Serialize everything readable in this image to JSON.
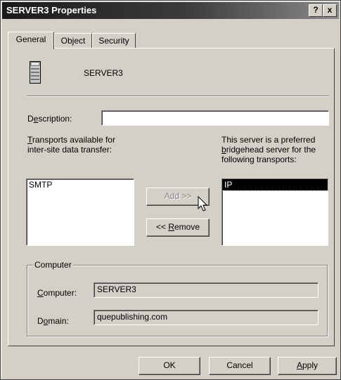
{
  "window": {
    "title": "SERVER3 Properties",
    "help_button": "?",
    "close_button": "x"
  },
  "tabs": [
    {
      "label": "General",
      "active": true
    },
    {
      "label": "Object",
      "active": false
    },
    {
      "label": "Security",
      "active": false
    }
  ],
  "server": {
    "icon": "server-icon",
    "name": "SERVER3"
  },
  "description": {
    "label_pre": "D",
    "label_u": "e",
    "label_post": "scription:",
    "value": ""
  },
  "transports_available": {
    "label_u": "T",
    "label_line1_post": "ransports available for",
    "label_line2": "inter-site data transfer:",
    "items": [
      "SMTP"
    ]
  },
  "preferred": {
    "label_line1": "This server is a preferred",
    "label_line2_u": "b",
    "label_line2_post": "ridgehead server for the",
    "label_line3": "following transports:",
    "items": [
      "IP"
    ]
  },
  "buttons": {
    "add": "Add >>",
    "remove_pre": "<< ",
    "remove_u": "R",
    "remove_post": "emove"
  },
  "computer_group": {
    "title": "Computer",
    "computer_label_pre": "",
    "computer_label_u": "C",
    "computer_label_post": "omputer:",
    "computer_value": "SERVER3",
    "domain_label_pre": "D",
    "domain_label_u": "o",
    "domain_label_post": "main:",
    "domain_value": "quepublishing.com"
  },
  "footer": {
    "ok": "OK",
    "cancel": "Cancel",
    "apply_u": "A",
    "apply_post": "pply"
  }
}
